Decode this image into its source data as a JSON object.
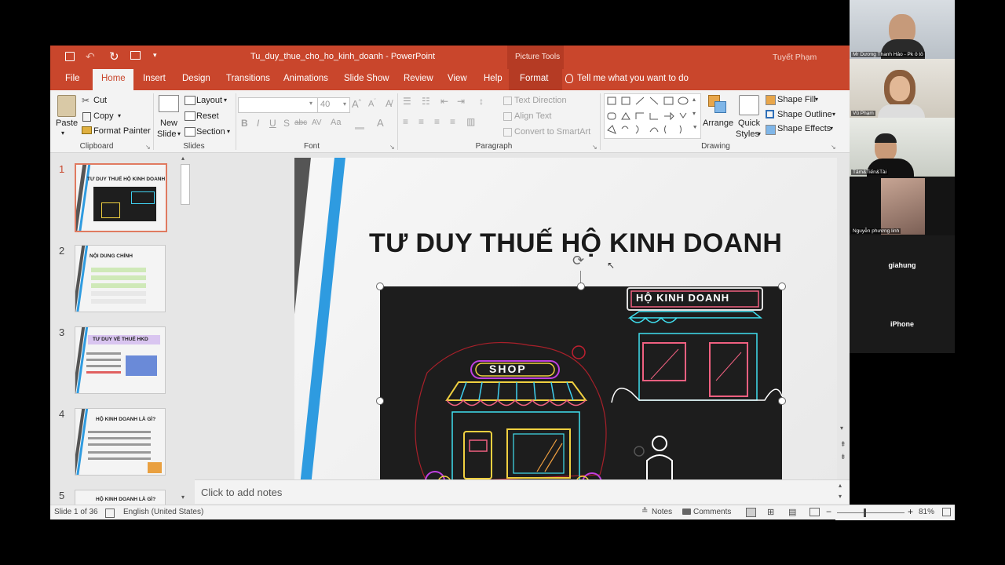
{
  "window": {
    "file_name": "Tu_duy_thue_cho_ho_kinh_doanh",
    "separator": "-",
    "app_name": "PowerPoint",
    "picture_tools": "Picture Tools",
    "user_name": "Tuyết Phạm"
  },
  "tabs": [
    "File",
    "Home",
    "Insert",
    "Design",
    "Transitions",
    "Animations",
    "Slide Show",
    "Review",
    "View",
    "Help",
    "Format"
  ],
  "tell_me": "Tell me what you want to do",
  "ribbon": {
    "clipboard": {
      "paste": "Paste",
      "cut": "Cut",
      "copy": "Copy",
      "format_painter": "Format Painter",
      "label": "Clipboard"
    },
    "slides": {
      "new_slide_1": "New",
      "new_slide_2": "Slide",
      "layout": "Layout",
      "reset": "Reset",
      "section": "Section",
      "label": "Slides"
    },
    "font": {
      "size": "40",
      "bold": "B",
      "italic": "I",
      "underline": "U",
      "shadow": "S",
      "strike": "abc",
      "spacing": "AV",
      "case": "Aa",
      "label": "Font"
    },
    "paragraph": {
      "text_direction": "Text Direction",
      "align_text": "Align Text",
      "smartart": "Convert to SmartArt",
      "label": "Paragraph"
    },
    "drawing": {
      "arrange": "Arrange",
      "quick_1": "Quick",
      "quick_2": "Styles",
      "shape_fill": "Shape Fill",
      "shape_outline": "Shape Outline",
      "shape_effects": "Shape Effects",
      "label": "Drawing"
    }
  },
  "thumbnails": [
    {
      "num": "1",
      "title": "TƯ DUY THUẾ HỘ KINH DOANH"
    },
    {
      "num": "2",
      "title": "NỘI DUNG CHÍNH"
    },
    {
      "num": "3",
      "title": "TƯ DUY VỀ THUẾ HKD"
    },
    {
      "num": "4",
      "title": "HỘ KINH DOANH LÀ GÌ?"
    },
    {
      "num": "5",
      "title": "HỘ KINH DOANH LÀ GÌ?"
    }
  ],
  "slide": {
    "title": "TƯ DUY THUẾ HỘ KINH DOANH",
    "shop_sign": "SHOP",
    "store_sign": "HỘ KINH DOANH"
  },
  "notes_placeholder": "Click to add notes",
  "status": {
    "slide_info": "Slide 1 of 36",
    "language": "English (United States)",
    "notes": "Notes",
    "comments": "Comments",
    "zoom": "81%"
  },
  "participants": [
    {
      "name": "Mr Dương Thanh Hảo - Pk ô tô"
    },
    {
      "name": "Vũ Phạm"
    },
    {
      "name": "Tâm&Tiến&Tài"
    },
    {
      "name": "Nguyễn phương linh"
    },
    {
      "name": "giahung"
    },
    {
      "name": "iPhone"
    }
  ],
  "colors": {
    "accent": "#c9462c",
    "slide_blue": "#2e9be0",
    "slide_gray": "#555555"
  }
}
